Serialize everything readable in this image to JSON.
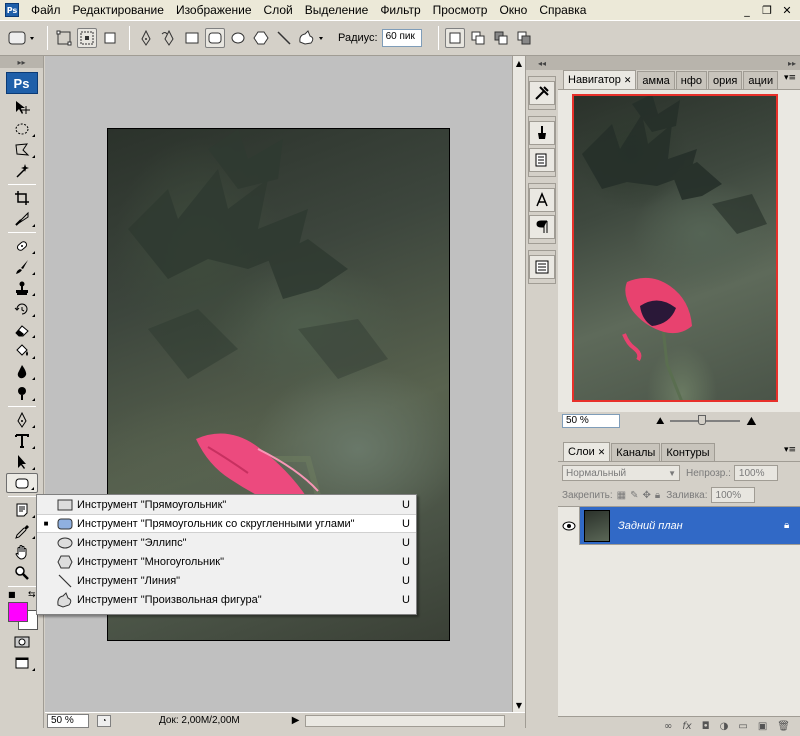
{
  "app": {
    "logo": "Ps"
  },
  "menu": [
    "Файл",
    "Редактирование",
    "Изображение",
    "Слой",
    "Выделение",
    "Фильтр",
    "Просмотр",
    "Окно",
    "Справка"
  ],
  "options": {
    "radius_label": "Радиус:",
    "radius_value": "60 пик"
  },
  "status": {
    "zoom": "50 %",
    "doc": "Док: 2,00M/2,00M"
  },
  "flyout": [
    {
      "label": "Инструмент \"Прямоугольник\"",
      "key": "U",
      "selected": false,
      "icon": "rectangle-icon"
    },
    {
      "label": "Инструмент \"Прямоугольник со скругленными углами\"",
      "key": "U",
      "selected": true,
      "icon": "rounded-rectangle-icon"
    },
    {
      "label": "Инструмент \"Эллипс\"",
      "key": "U",
      "selected": false,
      "icon": "ellipse-icon"
    },
    {
      "label": "Инструмент \"Многоугольник\"",
      "key": "U",
      "selected": false,
      "icon": "polygon-icon"
    },
    {
      "label": "Инструмент \"Линия\"",
      "key": "U",
      "selected": false,
      "icon": "line-icon"
    },
    {
      "label": "Инструмент \"Произвольная фигура\"",
      "key": "U",
      "selected": false,
      "icon": "custom-shape-icon"
    }
  ],
  "navigator": {
    "tabs": [
      "Навигатор",
      "амма",
      "нфо",
      "ория",
      "ации"
    ],
    "zoom": "50 %",
    "frame_color": "#e8302a"
  },
  "layers": {
    "tabs": [
      "Слои",
      "Каналы",
      "Контуры"
    ],
    "blend_mode": "Нормальный",
    "opacity_label": "Непрозр.:",
    "opacity_value": "100%",
    "lock_label": "Закрепить:",
    "fill_label": "Заливка:",
    "fill_value": "100%",
    "layer_name": "Задний план",
    "selected_color": "#3169c6"
  },
  "colors": {
    "foreground": "#ff00ff",
    "background": "#ffffff"
  }
}
